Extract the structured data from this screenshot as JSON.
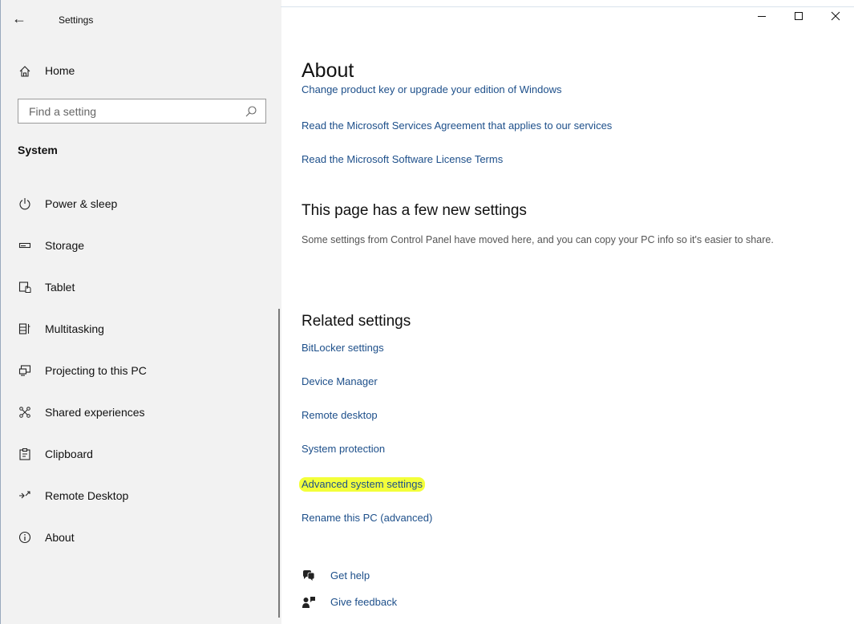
{
  "window": {
    "title": "Settings",
    "controls": [
      "minimize",
      "maximize",
      "close"
    ]
  },
  "sidebar": {
    "home_label": "Home",
    "search_placeholder": "Find a setting",
    "section_title": "System",
    "items": [
      {
        "label": "Power & sleep",
        "icon": "power-icon"
      },
      {
        "label": "Storage",
        "icon": "storage-icon"
      },
      {
        "label": "Tablet",
        "icon": "tablet-icon"
      },
      {
        "label": "Multitasking",
        "icon": "multitasking-icon"
      },
      {
        "label": "Projecting to this PC",
        "icon": "projecting-icon"
      },
      {
        "label": "Shared experiences",
        "icon": "shared-experiences-icon"
      },
      {
        "label": "Clipboard",
        "icon": "clipboard-icon"
      },
      {
        "label": "Remote Desktop",
        "icon": "remote-desktop-icon"
      },
      {
        "label": "About",
        "icon": "info-icon"
      }
    ]
  },
  "main": {
    "title": "About",
    "top_links": [
      "Change product key or upgrade your edition of Windows",
      "Read the Microsoft Services Agreement that applies to our services",
      "Read the Microsoft Software License Terms"
    ],
    "new_settings": {
      "heading": "This page has a few new settings",
      "description": "Some settings from Control Panel have moved here, and you can copy your PC info so it's easier to share."
    },
    "related": {
      "heading": "Related settings",
      "links": [
        "BitLocker settings",
        "Device Manager",
        "Remote desktop",
        "System protection",
        "Advanced system settings",
        "Rename this PC (advanced)"
      ],
      "highlighted_link": "Advanced system settings",
      "highlight_color": "#f3ff3a"
    },
    "help": {
      "get_help": "Get help",
      "give_feedback": "Give feedback"
    }
  },
  "colors": {
    "link": "#1d4f8a",
    "sidebar_bg": "#f2f2f2"
  }
}
